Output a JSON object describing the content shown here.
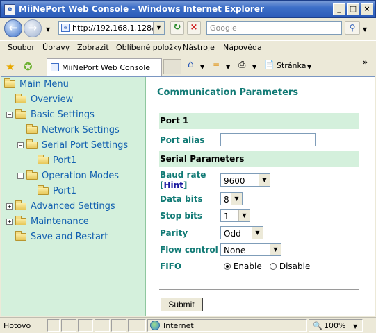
{
  "window": {
    "title": "MiiNePort Web Console - Windows Internet Explorer",
    "buttons": {
      "minimize": "_",
      "maximize": "□",
      "close": "×"
    }
  },
  "addressbar": {
    "url": "http://192.168.1.128/",
    "search_placeholder": "Google"
  },
  "menubar": [
    "Soubor",
    "Úpravy",
    "Zobrazit",
    "Oblíbené položky",
    "Nástroje",
    "Nápověda"
  ],
  "tabbar": {
    "tab_label": "MiiNePort Web Console",
    "page_menu": "Stránka"
  },
  "sidebar": {
    "items": [
      {
        "label": "Main Menu"
      },
      {
        "label": "Overview"
      },
      {
        "label": "Basic Settings"
      },
      {
        "label": "Network Settings"
      },
      {
        "label": "Serial Port Settings"
      },
      {
        "label": "Port1"
      },
      {
        "label": "Operation Modes"
      },
      {
        "label": "Port1"
      },
      {
        "label": "Advanced Settings"
      },
      {
        "label": "Maintenance"
      },
      {
        "label": "Save and Restart"
      }
    ]
  },
  "main": {
    "heading": "Communication Parameters",
    "port_section": "Port 1",
    "port_alias_label": "Port alias",
    "port_alias_value": "",
    "serial_section": "Serial Parameters",
    "baud_label": "Baud rate",
    "hint_label": "Hint",
    "baud_value": "9600",
    "databits_label": "Data bits",
    "databits_value": "8",
    "stopbits_label": "Stop bits",
    "stopbits_value": "1",
    "parity_label": "Parity",
    "parity_value": "Odd",
    "flow_label": "Flow control",
    "flow_value": "None",
    "fifo_label": "FIFO",
    "fifo_enable": "Enable",
    "fifo_disable": "Disable",
    "fifo_selected": "Enable",
    "submit_label": "Submit"
  },
  "statusbar": {
    "status": "Hotovo",
    "zone": "Internet",
    "zoom": "100%"
  },
  "colors": {
    "accent": "#117a75",
    "sidebar_bg": "#d4f0dc",
    "link": "#1260b0"
  }
}
